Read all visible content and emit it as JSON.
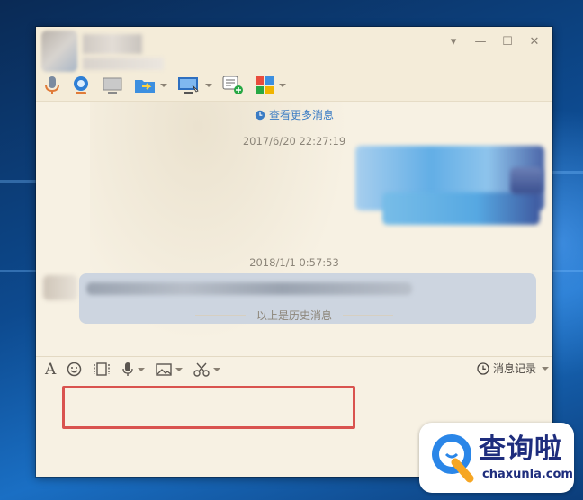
{
  "window": {
    "controls": [
      "▾",
      "—",
      "☐",
      "✕"
    ]
  },
  "toolbar": {
    "icons": [
      "microphone-icon",
      "video-camera-icon",
      "screen-share-icon",
      "folder-transfer-icon",
      "remote-desktop-icon",
      "new-message-icon",
      "app-grid-icon"
    ]
  },
  "messages": {
    "more_link": "查看更多消息",
    "items": [
      {
        "timestamp": "2017/6/20 22:27:19",
        "side": "right"
      },
      {
        "timestamp": "2018/1/1 0:57:53",
        "side": "left"
      }
    ],
    "history_divider": "以上是历史消息"
  },
  "input_toolbar": {
    "font_label": "A",
    "history_label": "消息记录"
  },
  "colors": {
    "window_bg": "#f7f1e3",
    "link": "#3b7cc4",
    "highlight": "#d9534f",
    "watermark_text": "#1e2d7d"
  },
  "watermark": {
    "title": "查询啦",
    "subtitle": "chaxunla.com"
  }
}
